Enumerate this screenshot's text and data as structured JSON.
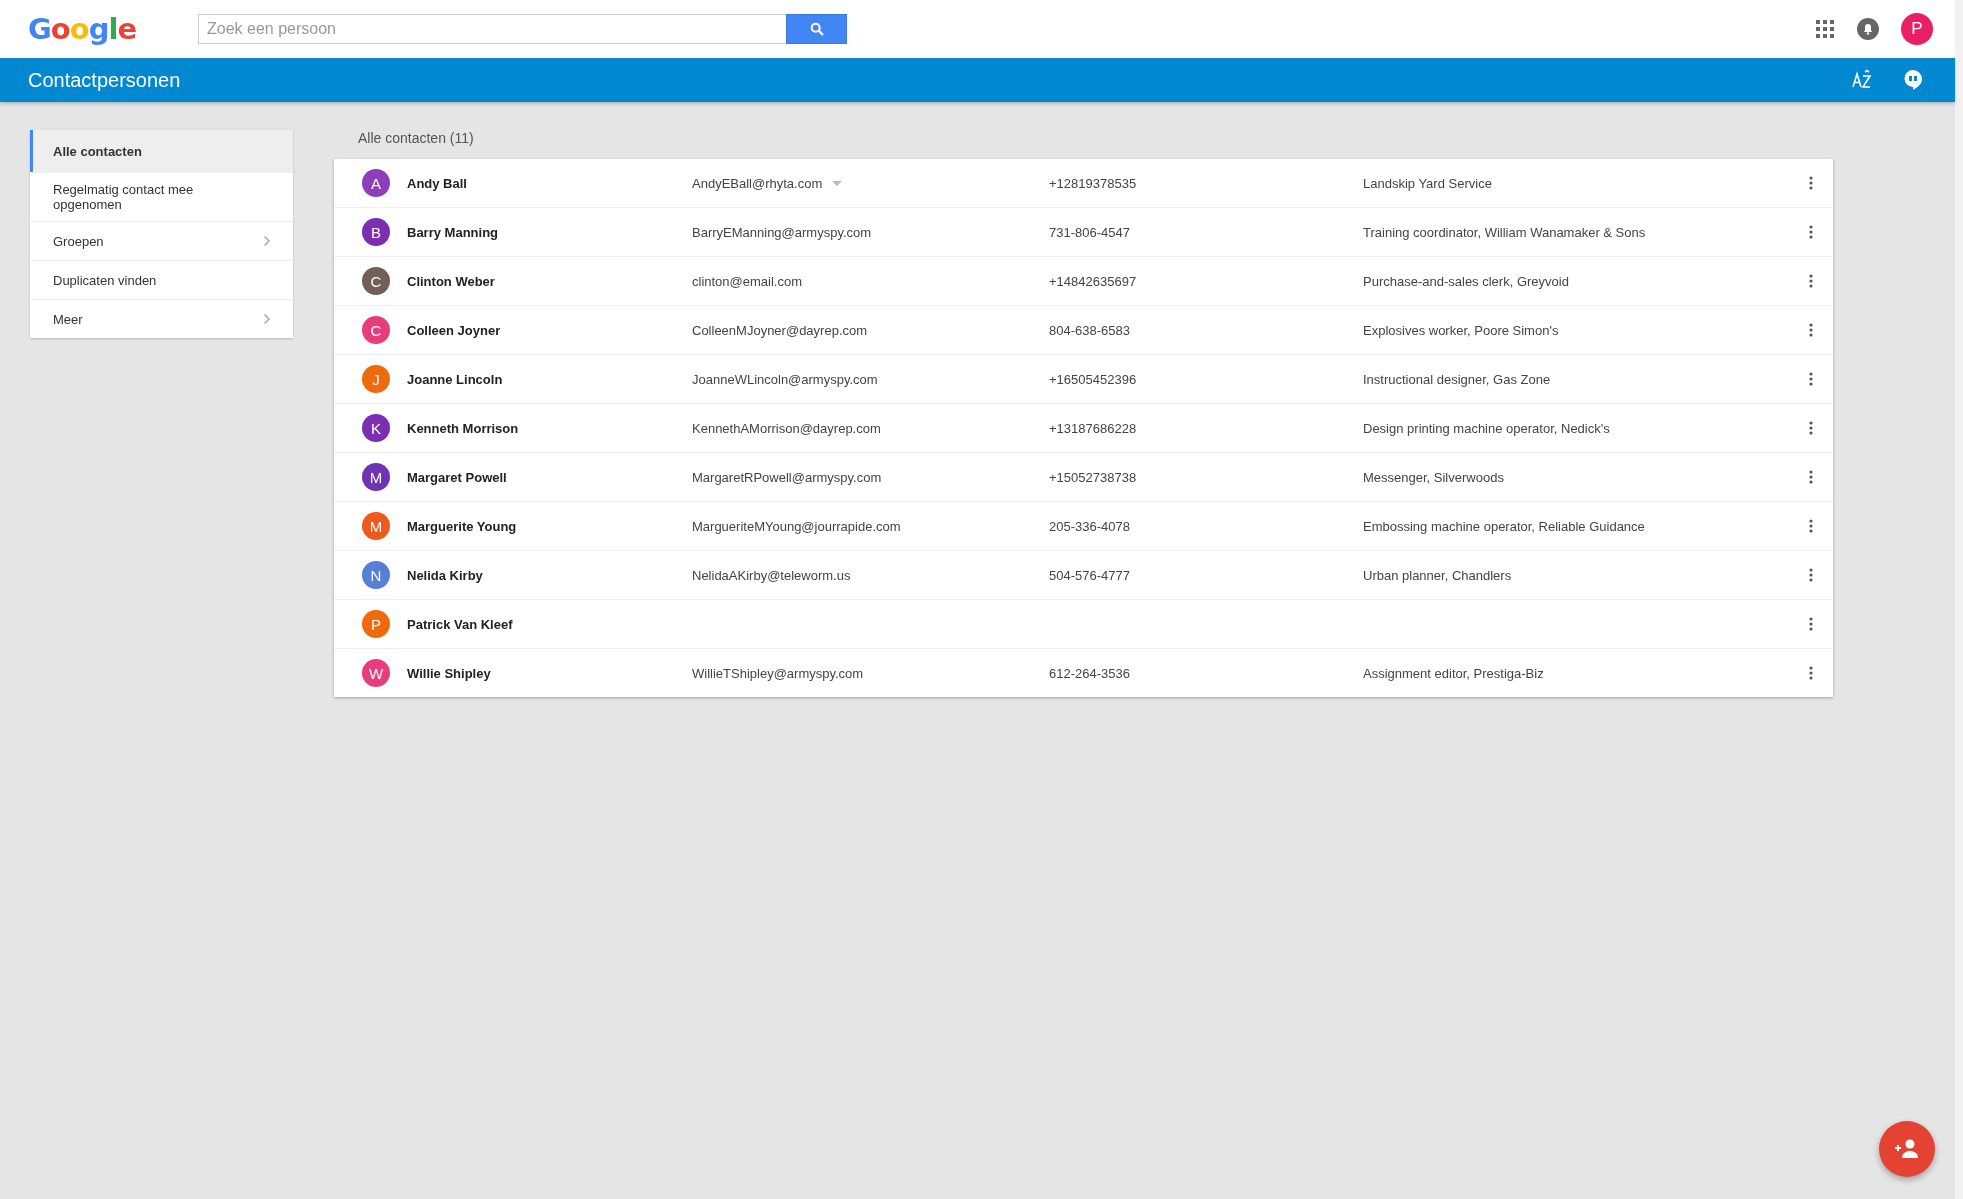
{
  "header": {
    "logo": "Google",
    "search": {
      "placeholder": "Zoek een persoon"
    },
    "account_initial": "P"
  },
  "app_bar": {
    "title": "Contactpersonen"
  },
  "sidebar": {
    "items": [
      {
        "label": "Alle contacten",
        "selected": true,
        "has_submenu": false
      },
      {
        "label": "Regelmatig contact mee opgenomen",
        "selected": false,
        "has_submenu": false
      },
      {
        "label": "Groepen",
        "selected": false,
        "has_submenu": true
      },
      {
        "label": "Duplicaten vinden",
        "selected": false,
        "has_submenu": false
      },
      {
        "label": "Meer",
        "selected": false,
        "has_submenu": true
      }
    ]
  },
  "list": {
    "heading": "Alle contacten (11)",
    "rows": [
      {
        "initial": "A",
        "color": "#8e3dbb",
        "name": "Andy Ball",
        "email": "AndyEBall@rhyta.com",
        "email_dropdown": true,
        "phone": "+12819378535",
        "job": "Landskip Yard Service"
      },
      {
        "initial": "B",
        "color": "#7b2fb0",
        "name": "Barry Manning",
        "email": "BarryEManning@armyspy.com",
        "email_dropdown": false,
        "phone": "731-806-4547",
        "job": "Training coordinator, William Wanamaker & Sons"
      },
      {
        "initial": "C",
        "color": "#725f57",
        "name": "Clinton Weber",
        "email": "clinton@email.com",
        "email_dropdown": false,
        "phone": "+14842635697",
        "job": "Purchase-and-sales clerk, Greyvoid"
      },
      {
        "initial": "C",
        "color": "#e73e7b",
        "name": "Colleen Joyner",
        "email": "ColleenMJoyner@dayrep.com",
        "email_dropdown": false,
        "phone": "804-638-6583",
        "job": "Explosives worker, Poore Simon's"
      },
      {
        "initial": "J",
        "color": "#ef6a0c",
        "name": "Joanne Lincoln",
        "email": "JoanneWLincoln@armyspy.com",
        "email_dropdown": false,
        "phone": "+16505452396",
        "job": "Instructional designer, Gas Zone"
      },
      {
        "initial": "K",
        "color": "#7b2fb0",
        "name": "Kenneth Morrison",
        "email": "KennethAMorrison@dayrep.com",
        "email_dropdown": false,
        "phone": "+13187686228",
        "job": "Design printing machine operator, Nedick's"
      },
      {
        "initial": "M",
        "color": "#6f34b3",
        "name": "Margaret Powell",
        "email": "MargaretRPowell@armyspy.com",
        "email_dropdown": false,
        "phone": "+15052738738",
        "job": "Messenger, Silverwoods"
      },
      {
        "initial": "M",
        "color": "#ec5a1e",
        "name": "Marguerite Young",
        "email": "MargueriteMYoung@jourrapide.com",
        "email_dropdown": false,
        "phone": "205-336-4078",
        "job": "Embossing machine operator, Reliable Guidance"
      },
      {
        "initial": "N",
        "color": "#5580d6",
        "name": "Nelida Kirby",
        "email": "NelidaAKirby@teleworm.us",
        "email_dropdown": false,
        "phone": "504-576-4777",
        "job": "Urban planner, Chandlers"
      },
      {
        "initial": "P",
        "color": "#ef6a0c",
        "name": "Patrick Van Kleef",
        "email_dropdown": false
      },
      {
        "initial": "W",
        "color": "#e73e7b",
        "name": "Willie Shipley",
        "email": "WillieTShipley@armyspy.com",
        "email_dropdown": false,
        "phone": "612-264-3536",
        "job": "Assignment editor, Prestiga-Biz"
      }
    ]
  }
}
